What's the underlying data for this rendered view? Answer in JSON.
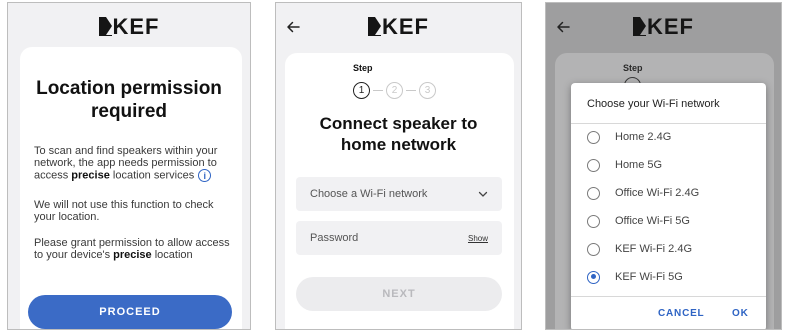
{
  "brand": {
    "logo_text": "KEF"
  },
  "panel1": {
    "title_line1": "Location permission",
    "title_line2": "required",
    "para1_part1": "To scan and find speakers within your network, the app needs permission to access ",
    "para1_bold": "precise",
    "para1_part2": " location services",
    "info_icon_glyph": "i",
    "para2": "We will not use this function to check your location.",
    "para3_part1": "Please grant permission to allow access to your device's ",
    "para3_bold": "precise",
    "para3_part2": " location",
    "proceed_label": "PROCEED"
  },
  "panel2": {
    "step_label": "Step",
    "steps": [
      "1",
      "2",
      "3"
    ],
    "title_line1": "Connect speaker to",
    "title_line2": "home network",
    "wifi_placeholder": "Choose a Wi-Fi network",
    "password_placeholder": "Password",
    "show_label": "Show",
    "next_label": "NEXT"
  },
  "panel3": {
    "step_label": "Step",
    "dialog_title": "Choose your Wi-Fi network",
    "networks": [
      "Home 2.4G",
      "Home 5G",
      "Office Wi-Fi 2.4G",
      "Office Wi-Fi 5G",
      "KEF Wi-Fi 2.4G",
      "KEF Wi-Fi 5G"
    ],
    "selected_index": 5,
    "cancel_label": "CANCEL",
    "ok_label": "OK"
  },
  "colors": {
    "accent": "#2f64c4",
    "primary_button": "#3b6bc6",
    "disabled_button": "#ececee"
  },
  "icons": [
    "back-arrow-icon",
    "chevron-down-icon",
    "info-icon",
    "radio-icon"
  ]
}
